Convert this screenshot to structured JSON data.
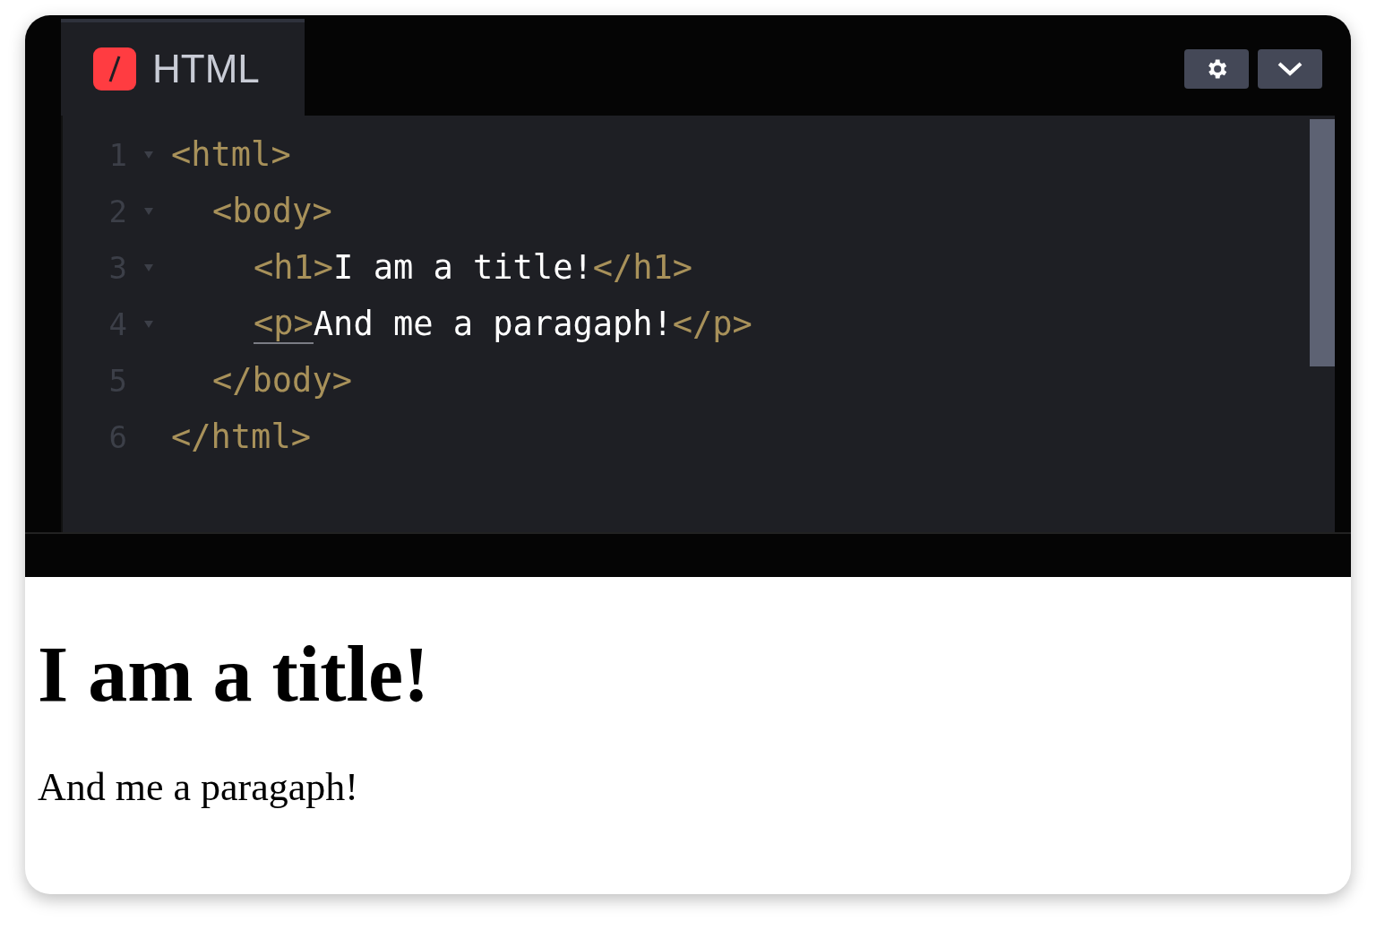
{
  "editor": {
    "tab": {
      "label": "HTML",
      "selected": true
    },
    "buttons": [
      {
        "kind": "settings"
      },
      {
        "kind": "expand"
      }
    ],
    "lines": [
      {
        "number": "1",
        "foldable": true,
        "tokens": [
          {
            "kind": "tag",
            "text": "<html>"
          }
        ],
        "children": [
          {
            "number": "2",
            "foldable": true,
            "tokens": [
              {
                "kind": "tag",
                "text": "<body>"
              }
            ],
            "children": [
              {
                "number": "3",
                "foldable": true,
                "tokens": [
                  {
                    "kind": "tag",
                    "text": "<h1>"
                  },
                  {
                    "kind": "text",
                    "text": "I am a title!"
                  },
                  {
                    "kind": "tag",
                    "text": "</h1>"
                  }
                ]
              },
              {
                "number": "4",
                "foldable": true,
                "tokens": [
                  {
                    "kind": "tag",
                    "text": "<p>",
                    "underlined": true
                  },
                  {
                    "kind": "text",
                    "text": "And me a paragaph!"
                  },
                  {
                    "kind": "tag",
                    "text": "</p>"
                  }
                ]
              }
            ]
          },
          {
            "number": "5",
            "foldable": false,
            "tokens": [
              {
                "kind": "tag",
                "text": "</body>"
              }
            ]
          }
        ]
      },
      {
        "number": "6",
        "foldable": false,
        "tokens": [
          {
            "kind": "tag",
            "text": "</html>"
          }
        ]
      }
    ]
  },
  "preview": {
    "heading": "I am a title!",
    "paragraph": "And me a paragaph!"
  }
}
